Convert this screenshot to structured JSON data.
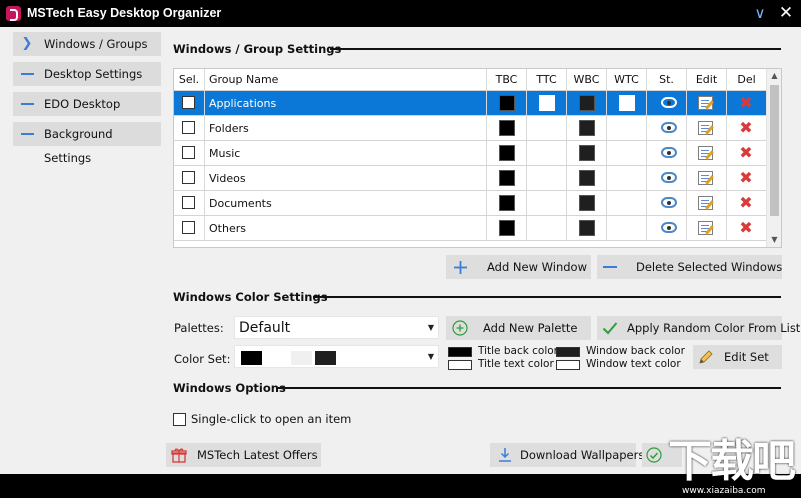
{
  "window": {
    "title": "MSTech Easy Desktop Organizer"
  },
  "sidebar": {
    "items": [
      {
        "label": "Windows / Groups",
        "icon": "chevron-right-icon"
      },
      {
        "label": "Desktop Settings",
        "icon": "dash-icon"
      },
      {
        "label": "EDO Desktop Settings",
        "icon": "dash-icon"
      },
      {
        "label": "Background Settings",
        "icon": "dash-icon"
      }
    ]
  },
  "groups_section": {
    "title": "Windows / Group Settings",
    "columns": [
      "Sel.",
      "Group Name",
      "TBC",
      "TTC",
      "WBC",
      "WTC",
      "St.",
      "Edit",
      "Del"
    ],
    "rows": [
      {
        "name": "Applications",
        "selected": true,
        "tbc": "#000000",
        "ttc": "#ffffff",
        "wbc": "#1f1f1f",
        "wtc": "#ffffff"
      },
      {
        "name": "Folders",
        "selected": false,
        "tbc": "#000000",
        "ttc": "#ffffff",
        "wbc": "#1f1f1f",
        "wtc": "#ffffff"
      },
      {
        "name": "Music",
        "selected": false,
        "tbc": "#000000",
        "ttc": "#ffffff",
        "wbc": "#1f1f1f",
        "wtc": "#ffffff"
      },
      {
        "name": "Videos",
        "selected": false,
        "tbc": "#000000",
        "ttc": "#ffffff",
        "wbc": "#1f1f1f",
        "wtc": "#ffffff"
      },
      {
        "name": "Documents",
        "selected": false,
        "tbc": "#000000",
        "ttc": "#ffffff",
        "wbc": "#1f1f1f",
        "wtc": "#ffffff"
      },
      {
        "name": "Others",
        "selected": false,
        "tbc": "#000000",
        "ttc": "#ffffff",
        "wbc": "#1f1f1f",
        "wtc": "#ffffff"
      }
    ],
    "add_window_label": "Add New Window",
    "delete_selected_label": "Delete Selected Windows"
  },
  "color_section": {
    "title": "Windows Color Settings",
    "palettes_label": "Palettes:",
    "palette_value": "Default",
    "add_palette_label": "Add New Palette",
    "apply_random_label": "Apply Random Color From List",
    "color_set_label": "Color Set:",
    "color_set_swatches": [
      "#000000",
      "#ffffff",
      "#f0f0f0",
      "#1f1f1f"
    ],
    "legend": {
      "title_back": "Title back color",
      "title_text": "Title text color",
      "window_back": "Window back color",
      "window_text": "Window text color"
    },
    "edit_set_label": "Edit Set"
  },
  "options_section": {
    "title": "Windows Options",
    "single_click_label": "Single-click to open an item",
    "single_click_checked": false
  },
  "footer": {
    "offers_label": "MSTech Latest Offers",
    "wallpapers_label": "Download Wallpapers"
  },
  "watermark": {
    "text": "下载吧",
    "url": "www.xiazaiba.com"
  },
  "colors": {
    "accent": "#0b78d7",
    "icon_blue": "#3d7bd9",
    "delete_red": "#d83b3b",
    "apply_green": "#2e9e3e"
  }
}
